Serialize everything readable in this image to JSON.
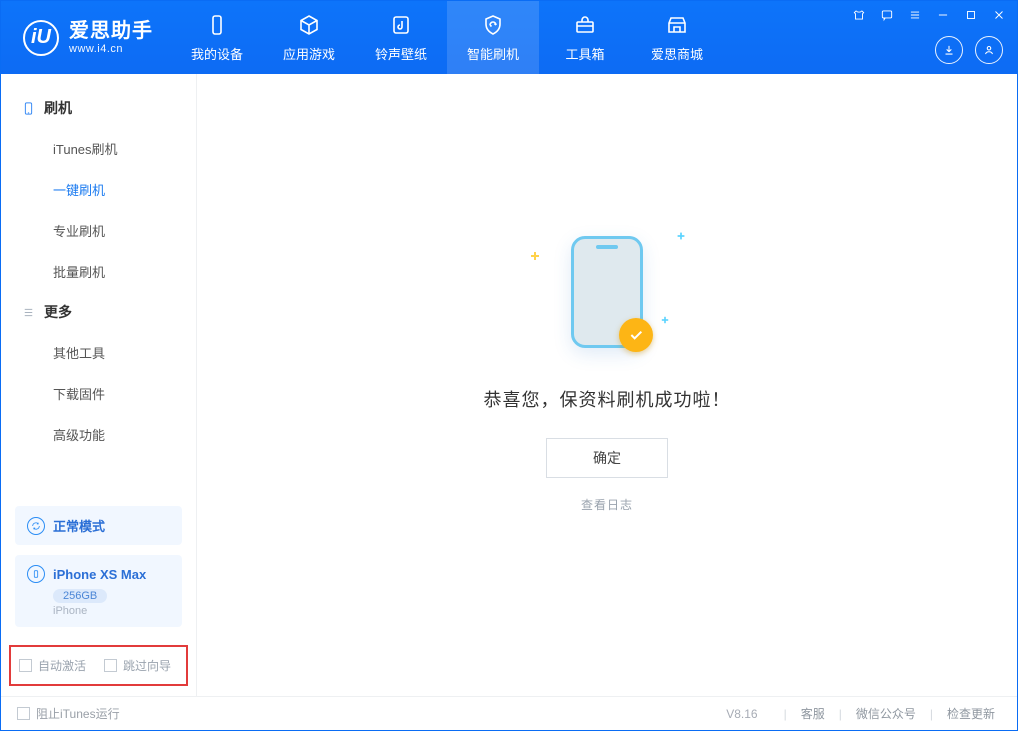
{
  "app": {
    "name_cn": "爱思助手",
    "url": "www.i4.cn"
  },
  "nav": {
    "tabs": [
      {
        "label": "我的设备"
      },
      {
        "label": "应用游戏"
      },
      {
        "label": "铃声壁纸"
      },
      {
        "label": "智能刷机"
      },
      {
        "label": "工具箱"
      },
      {
        "label": "爱思商城"
      }
    ],
    "active_index": 3
  },
  "sidebar": {
    "groups": [
      {
        "title": "刷机",
        "items": [
          {
            "label": "iTunes刷机"
          },
          {
            "label": "一键刷机",
            "active": true
          },
          {
            "label": "专业刷机"
          },
          {
            "label": "批量刷机"
          }
        ]
      },
      {
        "title": "更多",
        "items": [
          {
            "label": "其他工具"
          },
          {
            "label": "下载固件"
          },
          {
            "label": "高级功能"
          }
        ]
      }
    ],
    "mode_panel": {
      "label": "正常模式"
    },
    "device_panel": {
      "name": "iPhone XS Max",
      "capacity": "256GB",
      "type": "iPhone"
    },
    "options": {
      "auto_activate": "自动激活",
      "skip_guide": "跳过向导"
    }
  },
  "main": {
    "message": "恭喜您，保资料刷机成功啦！",
    "ok": "确定",
    "log_link": "查看日志"
  },
  "footer": {
    "block_itunes": "阻止iTunes运行",
    "version": "V8.16",
    "links": {
      "support": "客服",
      "wechat": "微信公众号",
      "update": "检查更新"
    }
  }
}
